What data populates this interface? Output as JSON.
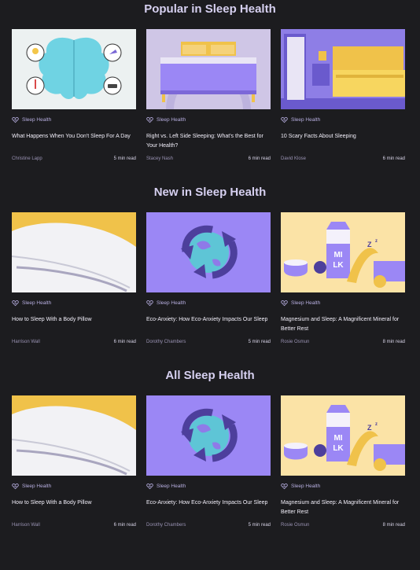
{
  "sections": [
    {
      "title": "Popular in Sleep Health",
      "cards": [
        {
          "tag": "Sleep Health",
          "title": "What Happens When You Don't Sleep For A Day",
          "author": "Christine Lapp",
          "read_time": "5 min read",
          "image": "brain-illustration"
        },
        {
          "tag": "Sleep Health",
          "title": "Right vs. Left Side Sleeping: What's the Best for Your Health?",
          "author": "Stacey Nash",
          "read_time": "6 min read",
          "image": "bed-illustration"
        },
        {
          "tag": "Sleep Health",
          "title": "10 Scary Facts About Sleeping",
          "author": "David Klose",
          "read_time": "6 min read",
          "image": "bedroom-illustration"
        }
      ]
    },
    {
      "title": "New in Sleep Health",
      "cards": [
        {
          "tag": "Sleep Health",
          "title": "How to Sleep With a Body Pillow",
          "author": "Harrison Wall",
          "read_time": "6 min read",
          "image": "pillow-photo"
        },
        {
          "tag": "Sleep Health",
          "title": "Eco-Anxiety: How Eco-Anxiety Impacts Our Sleep",
          "author": "Dorothy Chambers",
          "read_time": "5 min read",
          "image": "recycle-globe-illustration"
        },
        {
          "tag": "Sleep Health",
          "title": "Magnesium and Sleep: A Magnificent Mineral for Better Rest",
          "author": "Rosie Osmun",
          "read_time": "8 min read",
          "image": "milk-banana-illustration"
        }
      ]
    },
    {
      "title": "All Sleep Health",
      "cards": [
        {
          "tag": "Sleep Health",
          "title": "How to Sleep With a Body Pillow",
          "author": "Harrison Wall",
          "read_time": "6 min read",
          "image": "pillow-photo"
        },
        {
          "tag": "Sleep Health",
          "title": "Eco-Anxiety: How Eco-Anxiety Impacts Our Sleep",
          "author": "Dorothy Chambers",
          "read_time": "5 min read",
          "image": "recycle-globe-illustration"
        },
        {
          "tag": "Sleep Health",
          "title": "Magnesium and Sleep: A Magnificent Mineral for Better Rest",
          "author": "Rosie Osmun",
          "read_time": "8 min read",
          "image": "milk-banana-illustration"
        }
      ]
    }
  ],
  "colors": {
    "background": "#1c1c1f",
    "accent_purple": "#9b87f5",
    "accent_yellow": "#f0c24a",
    "tag_text": "#b7aee0"
  },
  "icons": {
    "tag_icon": "heart-icon"
  }
}
